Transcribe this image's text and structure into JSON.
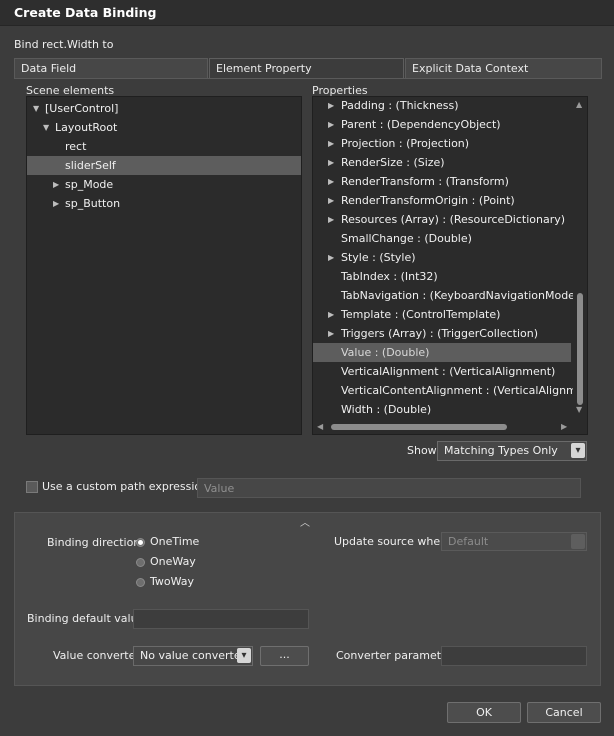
{
  "window": {
    "title": "Create Data Binding"
  },
  "bind_label": "Bind rect.Width to",
  "tabs": [
    {
      "label": "Data Field"
    },
    {
      "label": "Element Property"
    },
    {
      "label": "Explicit Data Context"
    }
  ],
  "scene": {
    "label": "Scene elements",
    "items": [
      {
        "label": "[UserControl]",
        "expand": "▼"
      },
      {
        "label": "LayoutRoot",
        "expand": "▼"
      },
      {
        "label": "rect",
        "expand": ""
      },
      {
        "label": "sliderSelf",
        "expand": ""
      },
      {
        "label": "sp_Mode",
        "expand": "▶"
      },
      {
        "label": "sp_Button",
        "expand": "▶"
      }
    ]
  },
  "properties": {
    "label": "Properties",
    "items": [
      {
        "label": "Padding : (Thickness)",
        "expand": "▶"
      },
      {
        "label": "Parent : (DependencyObject)",
        "expand": "▶"
      },
      {
        "label": "Projection : (Projection)",
        "expand": "▶"
      },
      {
        "label": "RenderSize : (Size)",
        "expand": "▶"
      },
      {
        "label": "RenderTransform : (Transform)",
        "expand": "▶"
      },
      {
        "label": "RenderTransformOrigin : (Point)",
        "expand": "▶"
      },
      {
        "label": "Resources (Array) : (ResourceDictionary)",
        "expand": "▶"
      },
      {
        "label": "SmallChange : (Double)",
        "expand": ""
      },
      {
        "label": "Style : (Style)",
        "expand": "▶"
      },
      {
        "label": "TabIndex : (Int32)",
        "expand": ""
      },
      {
        "label": "TabNavigation : (KeyboardNavigationMode)",
        "expand": ""
      },
      {
        "label": "Template : (ControlTemplate)",
        "expand": "▶"
      },
      {
        "label": "Triggers (Array) : (TriggerCollection)",
        "expand": "▶"
      },
      {
        "label": "Value : (Double)",
        "expand": ""
      },
      {
        "label": "VerticalAlignment : (VerticalAlignment)",
        "expand": ""
      },
      {
        "label": "VerticalContentAlignment : (VerticalAlignment)",
        "expand": ""
      },
      {
        "label": "Width : (Double)",
        "expand": ""
      }
    ]
  },
  "show": {
    "label": "Show",
    "value": "Matching Types Only",
    "chevron": "▾"
  },
  "custom_path": {
    "label": "Use a custom path expression",
    "placeholder": "Value"
  },
  "collapse_glyph": "︿",
  "binding_direction": {
    "label": "Binding direction",
    "options": [
      "OneTime",
      "OneWay",
      "TwoWay"
    ],
    "selected": "OneTime"
  },
  "update_source": {
    "label": "Update source when",
    "value": "Default"
  },
  "binding_default": {
    "label": "Binding default value",
    "value": ""
  },
  "value_converter": {
    "label": "Value converter",
    "value": "No value converter",
    "chevron": "▾",
    "more_label": "..."
  },
  "converter_parameter": {
    "label": "Converter parameter",
    "value": ""
  },
  "buttons": {
    "ok": "OK",
    "cancel": "Cancel"
  },
  "scroll_glyphs": {
    "up": "▲",
    "down": "▼",
    "left": "◀",
    "right": "▶"
  }
}
